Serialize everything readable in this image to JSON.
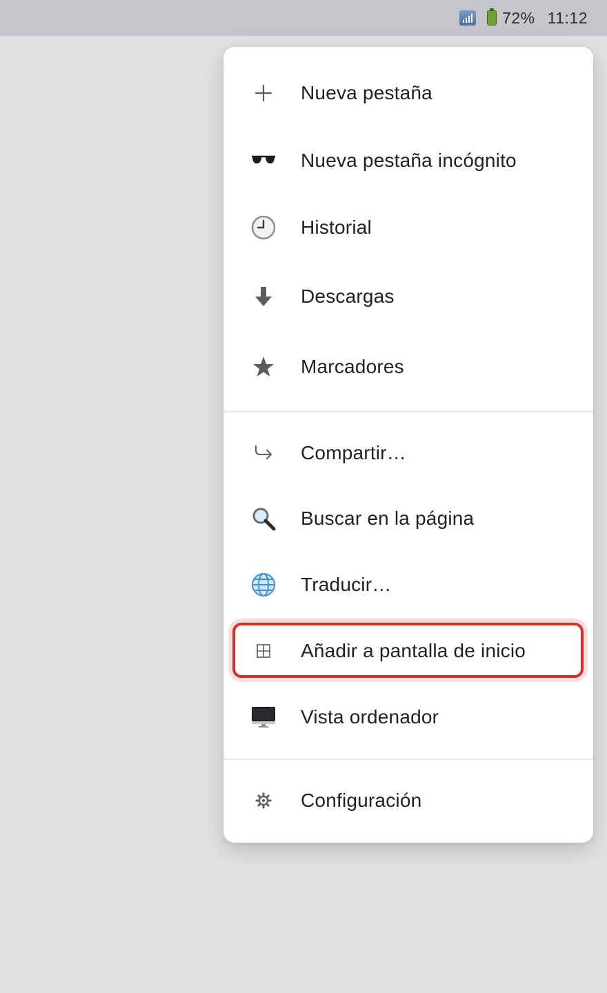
{
  "status_bar": {
    "battery_percent": "72%",
    "time": "11:12",
    "icons": [
      "signal-icon",
      "battery-icon"
    ]
  },
  "menu": {
    "items": [
      {
        "label": "Nueva pestaña",
        "icon": "plus-icon"
      },
      {
        "label": "Nueva pestaña incógnito",
        "icon": "sunglasses-icon"
      },
      {
        "label": "Historial",
        "icon": "clock-icon"
      },
      {
        "label": "Descargas",
        "icon": "download-arrow-icon"
      },
      {
        "label": "Marcadores",
        "icon": "star-icon"
      },
      {
        "label": "Compartir…",
        "icon": "share-arrow-icon"
      },
      {
        "label": "Buscar en la página",
        "icon": "magnifier-icon"
      },
      {
        "label": "Traducir…",
        "icon": "globe-icon"
      },
      {
        "label": "Añadir a pantalla de inicio",
        "icon": "add-to-home-grid-icon",
        "highlighted": true
      },
      {
        "label": "Vista ordenador",
        "icon": "desktop-monitor-icon"
      },
      {
        "label": "Configuración",
        "icon": "gear-icon"
      }
    ]
  },
  "colors": {
    "highlight": "#d2302a",
    "background": "#e1e2e4",
    "status_bar": "#c4c6cb",
    "icon": "#5b5c62"
  }
}
